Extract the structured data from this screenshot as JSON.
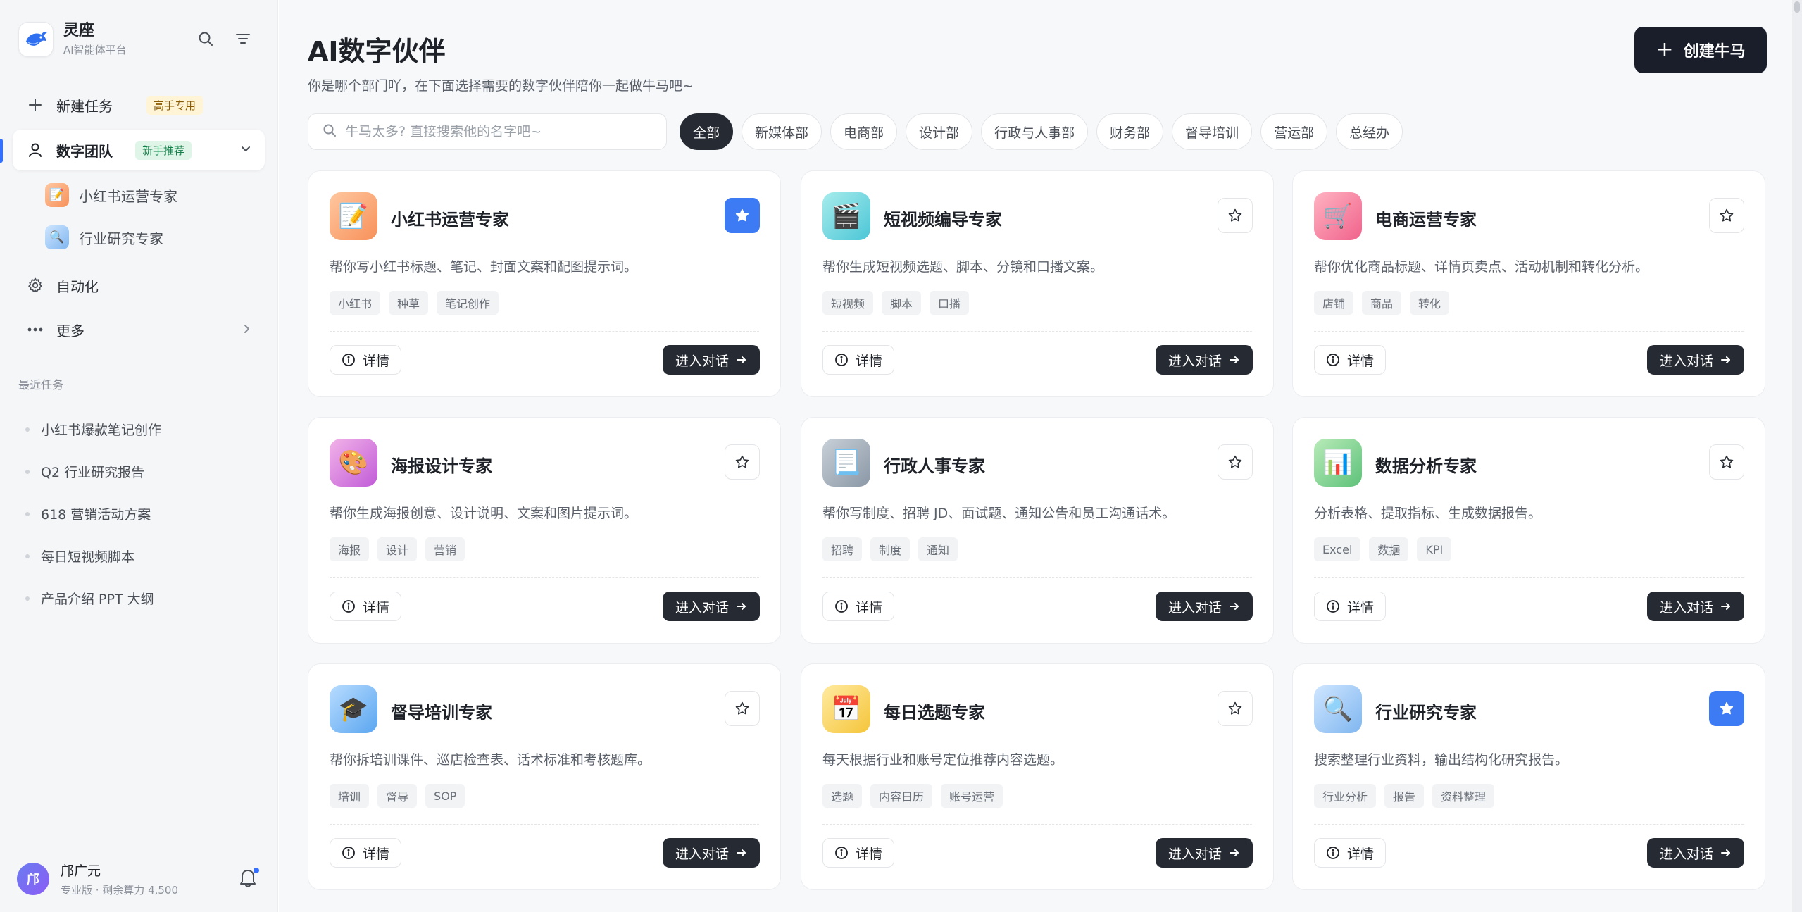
{
  "brand": {
    "name": "灵座",
    "subtitle": "AI智能体平台"
  },
  "sidebar": {
    "nav": [
      {
        "label": "新建任务",
        "badge": "高手专用"
      },
      {
        "label": "数字团队",
        "badge": "新手推荐"
      },
      {
        "label": "自动化"
      },
      {
        "label": "更多"
      }
    ],
    "sub_items": [
      {
        "label": "小红书运营专家",
        "icon": "memo-icon"
      },
      {
        "label": "行业研究专家",
        "icon": "magnifier-icon"
      }
    ],
    "recent_title": "最近任务",
    "recent": [
      "小红书爆款笔记创作",
      "Q2 行业研究报告",
      "618 营销活动方案",
      "每日短视频脚本",
      "产品介绍 PPT 大纲"
    ]
  },
  "profile": {
    "avatar_text": "邝",
    "name": "邝广元",
    "plan": "专业版 · 剩余算力 4,500"
  },
  "main": {
    "title": "AI数字伙伴",
    "subtitle": "你是哪个部门吖，在下面选择需要的数字伙伴陪你一起做牛马吧~",
    "create_label": "创建牛马",
    "search_placeholder": "牛马太多? 直接搜索他的名字吧~",
    "filters": [
      "全部",
      "新媒体部",
      "电商部",
      "设计部",
      "行政与人事部",
      "财务部",
      "督导培训",
      "营运部",
      "总经办"
    ],
    "detail_label": "详情",
    "chat_label": "进入对话"
  },
  "colors": {
    "accent": "#3d7bf5",
    "dark_button": "#262a33",
    "create_button": "#1a1e2b"
  },
  "agents": [
    {
      "title": "小红书运营专家",
      "desc": "帮你写小红书标题、笔记、封面文案和配图提示词。",
      "tags": [
        "小红书",
        "种草",
        "笔记创作"
      ],
      "favorited": true,
      "icon": "memo-icon",
      "emoji": "📝",
      "bg": "linear-gradient(135deg,#ffc7a0,#f7915a)"
    },
    {
      "title": "短视频编导专家",
      "desc": "帮你生成短视频选题、脚本、分镜和口播文案。",
      "tags": [
        "短视频",
        "脚本",
        "口播"
      ],
      "favorited": false,
      "icon": "clapper-icon",
      "emoji": "🎬",
      "bg": "linear-gradient(135deg,#a6ecec,#4cc6d6)"
    },
    {
      "title": "电商运营专家",
      "desc": "帮你优化商品标题、详情页卖点、活动机制和转化分析。",
      "tags": [
        "店铺",
        "商品",
        "转化"
      ],
      "favorited": false,
      "icon": "cart-icon",
      "emoji": "🛒",
      "bg": "linear-gradient(135deg,#ffb3c3,#f0628a)"
    },
    {
      "title": "海报设计专家",
      "desc": "帮你生成海报创意、设计说明、文案和图片提示词。",
      "tags": [
        "海报",
        "设计",
        "营销"
      ],
      "favorited": false,
      "icon": "palette-icon",
      "emoji": "🎨",
      "bg": "linear-gradient(135deg,#f2b3e8,#c15bd8)"
    },
    {
      "title": "行政人事专家",
      "desc": "帮你写制度、招聘 JD、面试题、通知公告和员工沟通话术。",
      "tags": [
        "招聘",
        "制度",
        "通知"
      ],
      "favorited": false,
      "icon": "document-icon",
      "emoji": "📃",
      "bg": "linear-gradient(135deg,#c8d0d8,#8a97a5)"
    },
    {
      "title": "数据分析专家",
      "desc": "分析表格、提取指标、生成数据报告。",
      "tags": [
        "Excel",
        "数据",
        "KPI"
      ],
      "favorited": false,
      "icon": "bar-chart-icon",
      "emoji": "📊",
      "bg": "linear-gradient(135deg,#b8ebb8,#5ec27a)"
    },
    {
      "title": "督导培训专家",
      "desc": "帮你拆培训课件、巡店检查表、话术标准和考核题库。",
      "tags": [
        "培训",
        "督导",
        "SOP"
      ],
      "favorited": false,
      "icon": "graduation-cap-icon",
      "emoji": "🎓",
      "bg": "linear-gradient(135deg,#b8dcff,#5aa6f0)"
    },
    {
      "title": "每日选题专家",
      "desc": "每天根据行业和账号定位推荐内容选题。",
      "tags": [
        "选题",
        "内容日历",
        "账号运营"
      ],
      "favorited": false,
      "icon": "calendar-icon",
      "emoji": "📅",
      "bg": "linear-gradient(135deg,#ffeaa0,#f5c53a)"
    },
    {
      "title": "行业研究专家",
      "desc": "搜索整理行业资料，输出结构化研究报告。",
      "tags": [
        "行业分析",
        "报告",
        "资料整理"
      ],
      "favorited": true,
      "icon": "magnifier-icon",
      "emoji": "🔍",
      "bg": "linear-gradient(135deg,#cfe6ff,#7fb6f0)"
    }
  ]
}
